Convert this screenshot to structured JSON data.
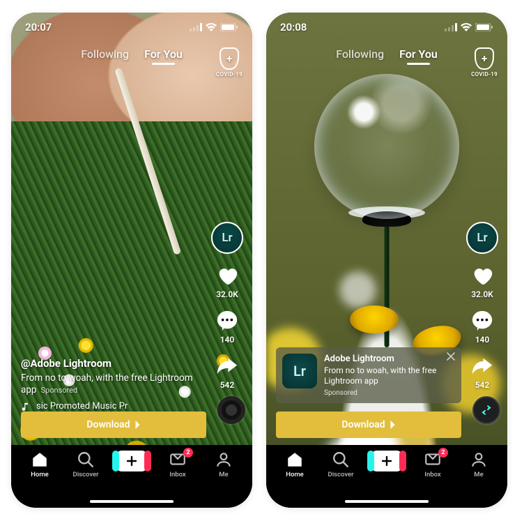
{
  "screens": [
    {
      "statusBar": {
        "time": "20:07"
      },
      "topNav": {
        "following": "Following",
        "forYou": "For You"
      },
      "covid": {
        "label": "COVID-19"
      },
      "avatar": {
        "text": "Lr"
      },
      "rail": {
        "likes": "32.0K",
        "comments": "140",
        "shares": "542"
      },
      "caption": {
        "user": "@Adobe Lightroom",
        "desc": "From no to woah, with the free Lightroom app",
        "sponsored": "Sponsored"
      },
      "music": {
        "text": "sic   Promoted Music   Pr"
      },
      "cta": {
        "label": "Download"
      },
      "tabs": {
        "home": "Home",
        "discover": "Discover",
        "inbox": "Inbox",
        "inboxBadge": "2",
        "me": "Me"
      }
    },
    {
      "statusBar": {
        "time": "20:08"
      },
      "topNav": {
        "following": "Following",
        "forYou": "For You"
      },
      "covid": {
        "label": "COVID-19"
      },
      "avatar": {
        "text": "Lr"
      },
      "rail": {
        "likes": "32.0K",
        "comments": "140",
        "shares": "542"
      },
      "adCard": {
        "thumb": "Lr",
        "title": "Adobe Lightroom",
        "desc": "From no to woah, with the free Lightroom app",
        "sponsored": "Sponsored"
      },
      "cta": {
        "label": "Download"
      },
      "tabs": {
        "home": "Home",
        "discover": "Discover",
        "inbox": "Inbox",
        "inboxBadge": "2",
        "me": "Me"
      }
    }
  ]
}
